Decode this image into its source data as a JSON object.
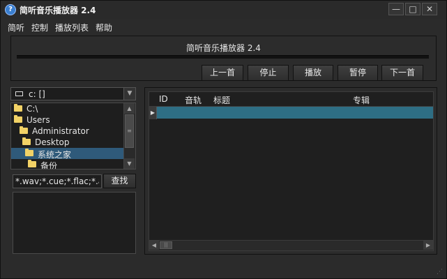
{
  "window": {
    "title": "简听音乐播放器 2.4",
    "icon": "question-circle-icon",
    "controls": {
      "minimize": "—",
      "maximize": "□",
      "close": "✕"
    }
  },
  "menu": [
    "简听",
    "控制",
    "播放列表",
    "帮助"
  ],
  "player": {
    "now_playing": "简听音乐播放器 2.4",
    "progress": 0,
    "buttons": {
      "prev": "上一首",
      "stop": "停止",
      "play": "播放",
      "pause": "暂停",
      "next": "下一首"
    }
  },
  "browser": {
    "drive": "c: []",
    "tree": [
      {
        "label": "C:\\",
        "level": 0,
        "selected": false
      },
      {
        "label": "Users",
        "level": 0,
        "selected": false
      },
      {
        "label": "Administrator",
        "level": 1,
        "selected": false
      },
      {
        "label": "Desktop",
        "level": 2,
        "selected": false
      },
      {
        "label": "系统之家",
        "level": 3,
        "selected": true
      },
      {
        "label": "备份",
        "level": 4,
        "selected": false
      }
    ],
    "filter_value": "*.wav;*.cue;*.flac;*.ape",
    "find_button": "查找"
  },
  "playlist": {
    "columns": [
      "ID",
      "音轨",
      "标题",
      "专辑"
    ],
    "row_indicator": "▶",
    "selected_row_color": "#2e6e84"
  },
  "colors": {
    "background": "#2b2b2b",
    "accent_selection": "#2f5a7a",
    "folder": "#f2d266"
  }
}
